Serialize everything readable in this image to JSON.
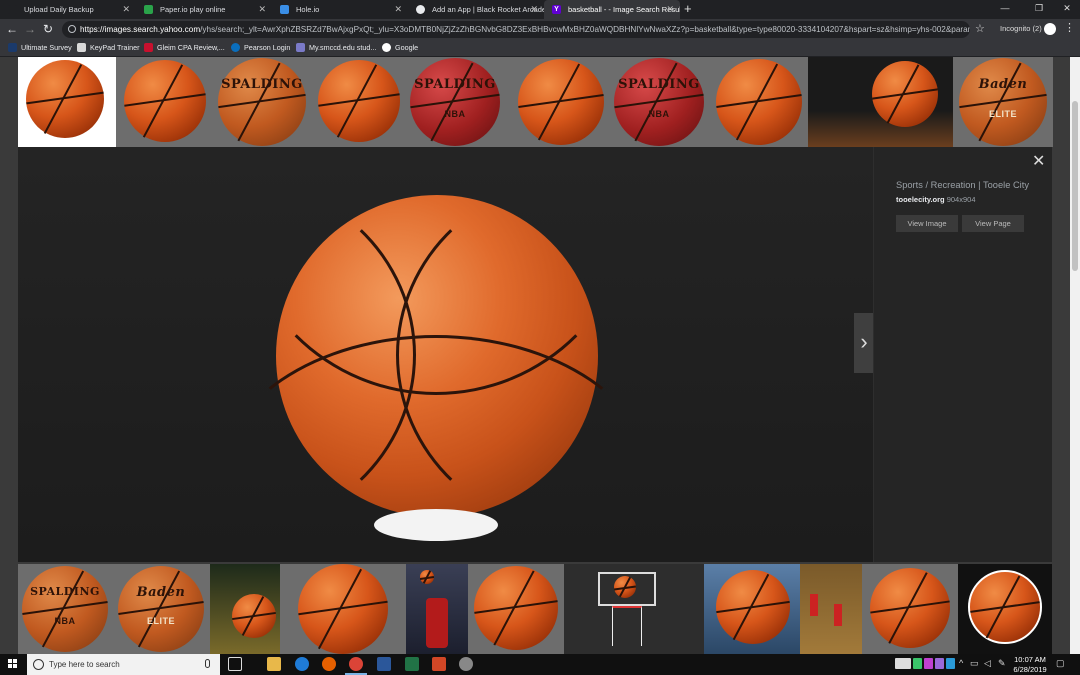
{
  "tabs": [
    {
      "label": "Upload Daily Backup",
      "color": "#202124",
      "active": false
    },
    {
      "label": "Paper.io play online",
      "color": "#2aa34a",
      "active": false
    },
    {
      "label": "Hole.io",
      "color": "#3a8ee6",
      "active": false
    },
    {
      "label": "Add an App | Black Rocket Arcade",
      "color": "#e8eaed",
      "active": false
    },
    {
      "label": "basketball - - Image Search Results",
      "color": "#6001d2",
      "active": true
    }
  ],
  "toolbar": {
    "url_host": "https://images.search.yahoo.com",
    "url_rest": "/yhs/search;_ylt=AwrXphZBSRZd7BwAjxgPxQt;_ylu=X3oDMTB0NjZjZzZhBGNvbG8DZ3ExBHBvcwMxBHZ0aWQDBHNlYwNwaXZz?p=basketball&type=type80020-3334104207&hspart=sz&hsimp=yhs-002&param1=169356...",
    "incognito_label": "Incognito (2)"
  },
  "bookmarks": [
    {
      "label": "Ultimate Survey",
      "color": "#1b3a6b"
    },
    {
      "label": "KeyPad Trainer",
      "color": "#d9d9d9"
    },
    {
      "label": "Gleim CPA Review,...",
      "color": "#c8102e"
    },
    {
      "label": "Pearson Login",
      "color": "#0a6ebd"
    },
    {
      "label": "My.smccd.edu stud...",
      "color": "#7a7ac8"
    },
    {
      "label": "Google",
      "color": "#ffffff"
    }
  ],
  "top_thumbnails": [
    {
      "brand": "",
      "style": "orange",
      "selected": true
    },
    {
      "brand": "",
      "style": "orange",
      "selected": false
    },
    {
      "brand": "SPALDING",
      "style": "orange",
      "selected": false
    },
    {
      "brand": "",
      "style": "orange",
      "selected": false
    },
    {
      "brand": "SPALDING",
      "style": "red",
      "selected": false
    },
    {
      "brand": "",
      "style": "orange",
      "selected": false
    },
    {
      "brand": "SPALDING",
      "style": "red",
      "selected": false
    },
    {
      "brand": "",
      "style": "orange",
      "selected": false
    },
    {
      "brand": "",
      "style": "court",
      "selected": false
    },
    {
      "brand": "Baden",
      "style": "tan",
      "selected": false
    }
  ],
  "top_thumb_marks": [
    "NBA",
    "NBA",
    "ELITE"
  ],
  "bottom_thumbnails": [
    {
      "brand": "SPALDING",
      "style": "orange"
    },
    {
      "brand": "Baden",
      "style": "tan"
    },
    {
      "brand": "",
      "style": "court"
    },
    {
      "brand": "",
      "style": "orange"
    },
    {
      "brand": "",
      "style": "player"
    },
    {
      "brand": "",
      "style": "orange"
    },
    {
      "brand": "",
      "style": "hoop"
    },
    {
      "brand": "",
      "style": "orange"
    },
    {
      "brand": "",
      "style": "court"
    },
    {
      "brand": "",
      "style": "orange"
    },
    {
      "brand": "",
      "style": "outline"
    }
  ],
  "bottom_thumb_marks": [
    "NBA",
    "ELITE"
  ],
  "preview": {
    "source_title": "Sports / Recreation | Tooele City",
    "source_host": "tooelecity.org",
    "dimensions": "904x904",
    "view_image_label": "View Image",
    "view_page_label": "View Page"
  },
  "taskbar": {
    "search_placeholder": "Type here to search",
    "time": "10:07 AM",
    "date": "6/28/2019"
  }
}
